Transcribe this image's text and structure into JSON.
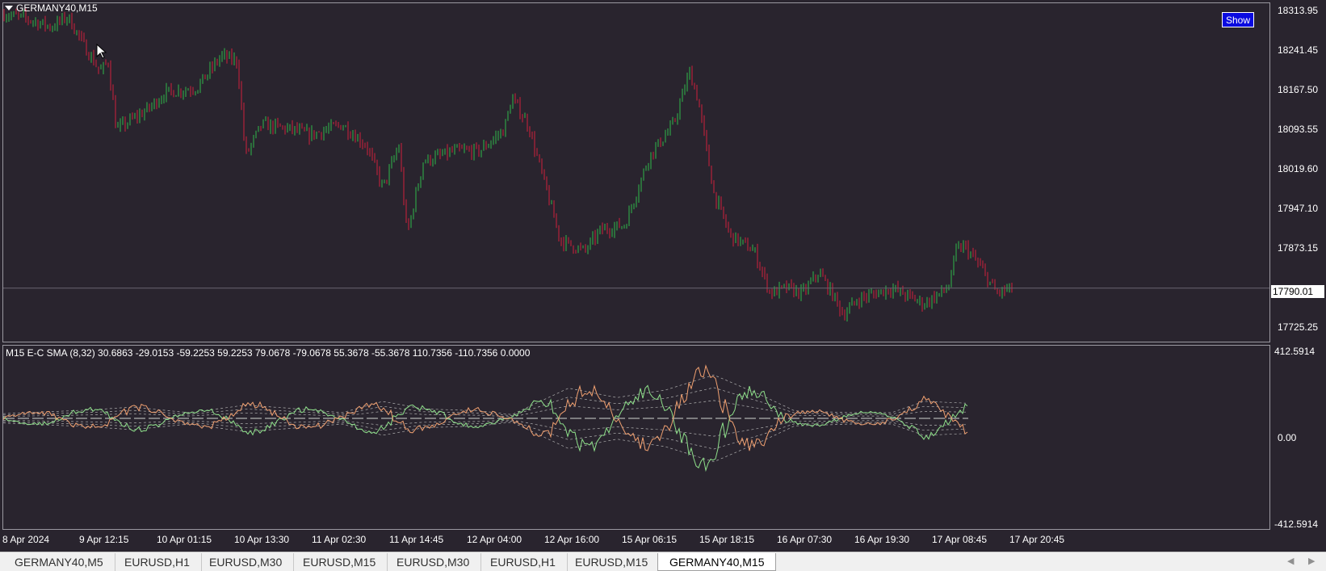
{
  "symbol_title": "GERMANY40,M15",
  "show_button": "Show",
  "price_axis": [
    "18313.95",
    "18241.45",
    "18167.50",
    "18093.55",
    "18019.60",
    "17947.10",
    "17873.15",
    "17725.25"
  ],
  "current_price": "17790.01",
  "indicator": {
    "title": "M15 E-C SMA (8,32) 30.6863 -29.0153 -59.2253 59.2253 79.0678 -79.0678 55.3678 -55.3678 110.7356 -110.7356 0.0000",
    "axis": [
      "412.5914",
      "0.00",
      "-412.5914"
    ]
  },
  "time_axis": [
    "8 Apr 2024",
    "9 Apr 12:15",
    "10 Apr 01:15",
    "10 Apr 13:30",
    "11 Apr 02:30",
    "11 Apr 14:45",
    "12 Apr 04:00",
    "12 Apr 16:00",
    "15 Apr 06:15",
    "15 Apr 18:15",
    "16 Apr 07:30",
    "16 Apr 19:30",
    "17 Apr 08:45",
    "17 Apr 20:45"
  ],
  "tabs": [
    "GERMANY40,M5",
    "EURUSD,H1",
    "EURUSD,M30",
    "EURUSD,M15",
    "EURUSD,M30",
    "EURUSD,H1",
    "EURUSD,M15",
    "GERMANY40,M15"
  ],
  "active_tab": 7,
  "colors": {
    "background": "#29242e",
    "bull": "#2fb84a",
    "bear": "#d01f3c",
    "ind_green": "#8ee08a",
    "ind_orange": "#f0a070",
    "guides": "#b0b0b0",
    "show_button": "#0a0ae0"
  },
  "chart_data": {
    "type": "candlestick",
    "symbol": "GERMANY40",
    "timeframe": "M15",
    "y_range": [
      17690,
      18330
    ],
    "close_path": [
      [
        0,
        18310
      ],
      [
        30,
        18300
      ],
      [
        60,
        18285
      ],
      [
        80,
        18305
      ],
      [
        100,
        18250
      ],
      [
        120,
        18200
      ],
      [
        130,
        18220
      ],
      [
        140,
        18090
      ],
      [
        160,
        18110
      ],
      [
        180,
        18130
      ],
      [
        200,
        18160
      ],
      [
        240,
        18170
      ],
      [
        270,
        18230
      ],
      [
        290,
        18220
      ],
      [
        300,
        18040
      ],
      [
        320,
        18100
      ],
      [
        360,
        18090
      ],
      [
        380,
        18080
      ],
      [
        420,
        18100
      ],
      [
        450,
        18060
      ],
      [
        470,
        17980
      ],
      [
        490,
        18060
      ],
      [
        500,
        17890
      ],
      [
        520,
        18030
      ],
      [
        560,
        18050
      ],
      [
        590,
        18050
      ],
      [
        620,
        18090
      ],
      [
        630,
        18150
      ],
      [
        650,
        18100
      ],
      [
        670,
        17990
      ],
      [
        690,
        17880
      ],
      [
        720,
        17860
      ],
      [
        740,
        17900
      ],
      [
        770,
        17910
      ],
      [
        800,
        18040
      ],
      [
        830,
        18100
      ],
      [
        850,
        18200
      ],
      [
        860,
        18150
      ],
      [
        880,
        17970
      ],
      [
        900,
        17890
      ],
      [
        930,
        17860
      ],
      [
        950,
        17780
      ],
      [
        970,
        17790
      ],
      [
        990,
        17780
      ],
      [
        1010,
        17820
      ],
      [
        1030,
        17770
      ],
      [
        1040,
        17740
      ],
      [
        1060,
        17770
      ],
      [
        1100,
        17790
      ],
      [
        1140,
        17760
      ],
      [
        1170,
        17790
      ],
      [
        1180,
        17860
      ],
      [
        1190,
        17870
      ],
      [
        1210,
        17830
      ],
      [
        1230,
        17780
      ],
      [
        1250,
        17790
      ]
    ]
  }
}
